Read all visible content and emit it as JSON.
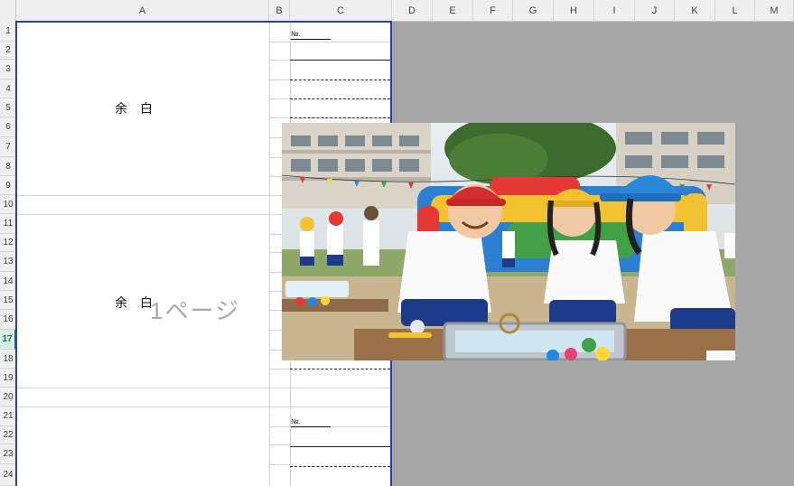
{
  "columns": [
    "A",
    "B",
    "C",
    "D",
    "E",
    "F",
    "G",
    "H",
    "I",
    "J",
    "K",
    "L",
    "M"
  ],
  "rows": [
    "1",
    "2",
    "3",
    "4",
    "5",
    "6",
    "7",
    "8",
    "9",
    "10",
    "11",
    "12",
    "13",
    "14",
    "15",
    "16",
    "17",
    "18",
    "19",
    "20",
    "21",
    "22",
    "23",
    "24"
  ],
  "selected_row": "17",
  "blocks": {
    "margin_top": "余　白",
    "margin_mid": "余　白",
    "no_label_1": "№.",
    "no_label_2": "№."
  },
  "page_watermark": "1ページ",
  "photo": {
    "icon": "school-festival-photo"
  },
  "colors": {
    "page_border": "#2d3fb1",
    "outside_area": "#a6a6a6",
    "selected_row_accent": "#217346"
  }
}
